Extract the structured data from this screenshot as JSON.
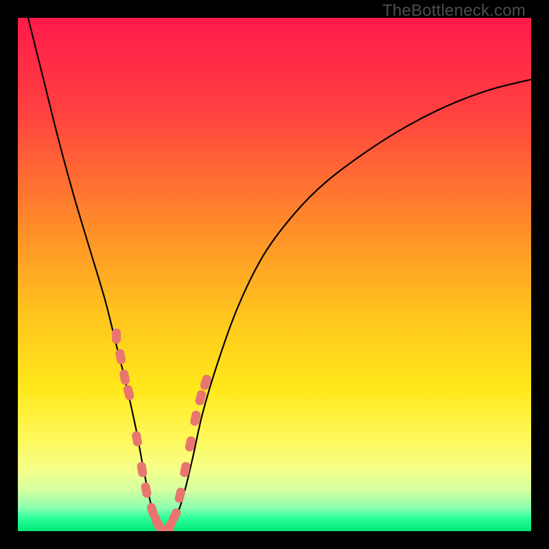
{
  "watermark": "TheBottleneck.com",
  "colors": {
    "gradient_stops": [
      {
        "offset": 0.0,
        "color": "#ff1a4a"
      },
      {
        "offset": 0.18,
        "color": "#ff4040"
      },
      {
        "offset": 0.4,
        "color": "#ff8a2a"
      },
      {
        "offset": 0.58,
        "color": "#ffc51e"
      },
      {
        "offset": 0.72,
        "color": "#ffe81a"
      },
      {
        "offset": 0.82,
        "color": "#fff85a"
      },
      {
        "offset": 0.88,
        "color": "#f5ff8a"
      },
      {
        "offset": 0.92,
        "color": "#d4ffa0"
      },
      {
        "offset": 0.955,
        "color": "#8affb0"
      },
      {
        "offset": 0.975,
        "color": "#2aff9a"
      },
      {
        "offset": 1.0,
        "color": "#00e878"
      }
    ],
    "marker": "#e8766f",
    "curve": "#000000",
    "frame": "#000000"
  },
  "chart_data": {
    "type": "line",
    "title": "",
    "xlabel": "",
    "ylabel": "",
    "xlim": [
      0,
      100
    ],
    "ylim": [
      0,
      100
    ],
    "legend": false,
    "grid": false,
    "series": [
      {
        "name": "bottleneck-curve",
        "x": [
          2,
          5,
          8,
          11,
          14,
          17,
          19,
          21,
          23,
          24.5,
          26,
          27.5,
          29,
          30,
          32,
          34,
          36,
          39,
          43,
          48,
          54,
          60,
          68,
          76,
          84,
          92,
          100
        ],
        "y": [
          100,
          88,
          76,
          65,
          55,
          45,
          37,
          29,
          20,
          12,
          5,
          1,
          0,
          1,
          6,
          14,
          23,
          33,
          44,
          54,
          62,
          68,
          74,
          79,
          83,
          86,
          88
        ]
      }
    ],
    "markers": {
      "name": "highlighted-points",
      "shape": "rounded-rect",
      "x": [
        19.2,
        20.0,
        20.8,
        21.6,
        23.2,
        24.2,
        25.0,
        26.2,
        27.0,
        27.6,
        28.0,
        28.6,
        29.0,
        29.6,
        30.6,
        31.6,
        32.6,
        33.6,
        34.6,
        35.6,
        36.6
      ],
      "y": [
        38,
        34,
        30,
        27,
        18,
        12,
        8,
        4,
        2,
        1,
        0,
        0,
        0,
        1,
        3,
        7,
        12,
        17,
        22,
        26,
        29
      ]
    }
  }
}
